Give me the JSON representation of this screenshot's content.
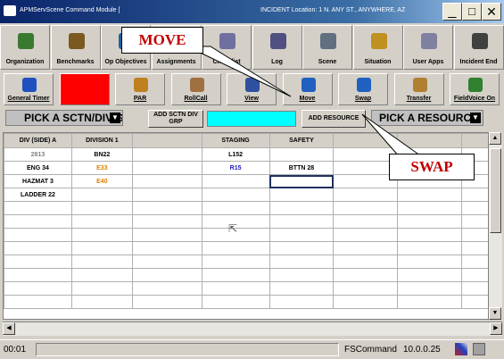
{
  "window": {
    "title": "APMServScene Command Module [",
    "title_suffix": "INCIDENT Location: 1 N. ANY ST., ANYWHERE, AZ",
    "minimize_label": "_",
    "maximize_label": "□",
    "close_label": "✕"
  },
  "toolbar_top": [
    {
      "label": "Organization",
      "icon": "org-chart-icon"
    },
    {
      "label": "Benchmarks",
      "icon": "benchmark-icon"
    },
    {
      "label": "Op Objectives",
      "icon": "objectives-icon"
    },
    {
      "label": "Assignments",
      "icon": "assignments-icon"
    },
    {
      "label": "Checklist",
      "icon": "checklist-icon"
    },
    {
      "label": "Log",
      "icon": "printer-icon"
    },
    {
      "label": "Scene",
      "icon": "scene-icon"
    },
    {
      "label": "Situation",
      "icon": "situation-icon"
    },
    {
      "label": "User Apps",
      "icon": "apps-icon"
    },
    {
      "label": "Incident End",
      "icon": "close-x-icon"
    }
  ],
  "toolbar_bottom": [
    {
      "label": "General Timer",
      "icon": "clock-icon"
    },
    {
      "label": "",
      "icon": "red-alert-icon"
    },
    {
      "label": "PAR",
      "icon": "par-icon"
    },
    {
      "label": "RollCall",
      "icon": "rollcall-icon"
    },
    {
      "label": "View",
      "icon": "eye-icon"
    },
    {
      "label": "Move",
      "icon": "move-arrows-icon"
    },
    {
      "label": "Swap",
      "icon": "swap-icon"
    },
    {
      "label": "Transfer",
      "icon": "transfer-icon"
    },
    {
      "label": "FieldVoice On",
      "icon": "speaker-icon"
    }
  ],
  "pick_bar": {
    "sector_select": "PICK A SCTN/DIV/G",
    "add_sctn_label": "ADD SCTN DIV GRP",
    "cyan_field_value": "",
    "add_resource_label": "ADD RESOURCE",
    "resource_select": "PICK A RESOURCE"
  },
  "grid": {
    "columns": [
      "DIV (SIDE) A",
      "DIVISION 1",
      "",
      "STAGING",
      "SAFETY",
      "",
      "",
      ""
    ],
    "rows": [
      [
        "2813",
        "BN22",
        "",
        "L152",
        "",
        "",
        "",
        ""
      ],
      [
        "ENG 34",
        "E33",
        "",
        "R15",
        "BTTN 28",
        "",
        "",
        ""
      ],
      [
        "HAZMAT 3",
        "E40",
        "",
        "",
        "",
        "",
        "",
        ""
      ],
      [
        "LADDER 22",
        "",
        "",
        "",
        "",
        "",
        "",
        ""
      ],
      [
        "",
        "",
        "",
        "",
        "",
        "",
        "",
        ""
      ],
      [
        "",
        "",
        "",
        "",
        "",
        "",
        "",
        ""
      ],
      [
        "",
        "",
        "",
        "",
        "",
        "",
        "",
        ""
      ],
      [
        "",
        "",
        "",
        "",
        "",
        "",
        "",
        ""
      ],
      [
        "",
        "",
        "",
        "",
        "",
        "",
        "",
        ""
      ],
      [
        "",
        "",
        "",
        "",
        "",
        "",
        "",
        ""
      ],
      [
        "",
        "",
        "",
        "",
        "",
        "",
        "",
        ""
      ],
      [
        "",
        "",
        "",
        "",
        "",
        "",
        "",
        ""
      ]
    ],
    "cell_colors": {
      "2813": "#808080",
      "E33": "#e08000",
      "E40": "#e08000",
      "R15": "#2020c0"
    }
  },
  "status": {
    "time": "00:01",
    "app": "FSCommand",
    "version": "10.0.0.25"
  },
  "callouts": {
    "move": "MOVE",
    "swap": "SWAP"
  },
  "colors": {
    "accent_red": "#c00000",
    "cyan": "#00ffff",
    "toolbar_bg": "#d4d0c8"
  }
}
